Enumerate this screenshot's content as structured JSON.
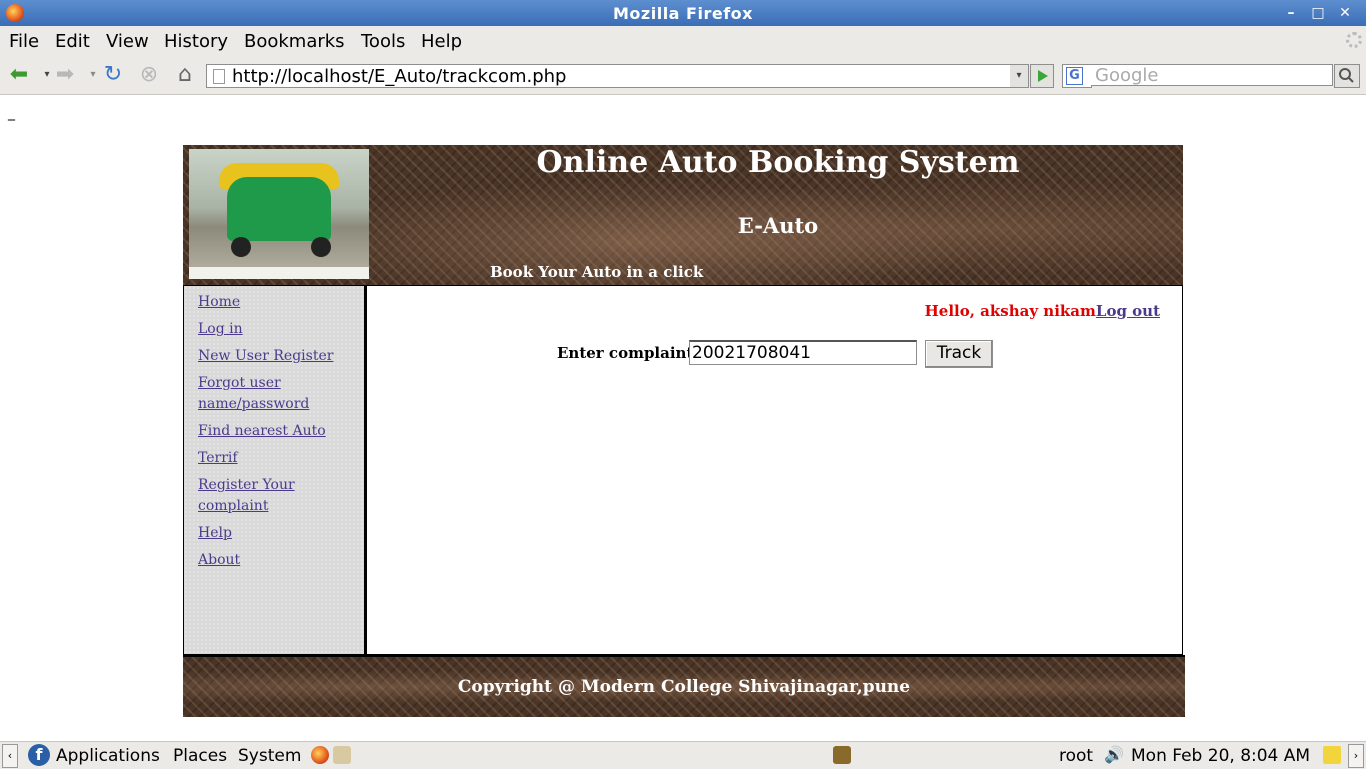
{
  "window": {
    "title": "Mozilla Firefox"
  },
  "menu": {
    "file": "File",
    "edit": "Edit",
    "view": "View",
    "history": "History",
    "bookmarks": "Bookmarks",
    "tools": "Tools",
    "help": "Help"
  },
  "nav": {
    "url": "http://localhost/E_Auto/trackcom.php",
    "search_placeholder": "Google"
  },
  "page": {
    "stray_text": "_",
    "header": {
      "title": "Online Auto Booking System",
      "subtitle": "E-Auto",
      "tagline": "Book Your Auto in a click"
    },
    "sidebar": {
      "home": "Home",
      "login": "Log in",
      "new_user": "New User Register",
      "forgot": "Forgot user name/password",
      "find_auto": "Find nearest Auto",
      "terrif": "Terrif",
      "register_complaint": "Register Your complaint",
      "help": "Help",
      "about": "About"
    },
    "greeting": {
      "hello": "Hello, akshay nikam",
      "logout": "Log out"
    },
    "track": {
      "label": "Enter complaint id",
      "value": "20021708041",
      "button": "Track"
    },
    "footer": {
      "copyright": "Copyright @ Modern College Shivajinagar,pune"
    }
  },
  "panel": {
    "applications": "Applications",
    "places": "Places",
    "system": "System",
    "user": "root",
    "datetime": "Mon Feb 20,  8:04 AM"
  }
}
